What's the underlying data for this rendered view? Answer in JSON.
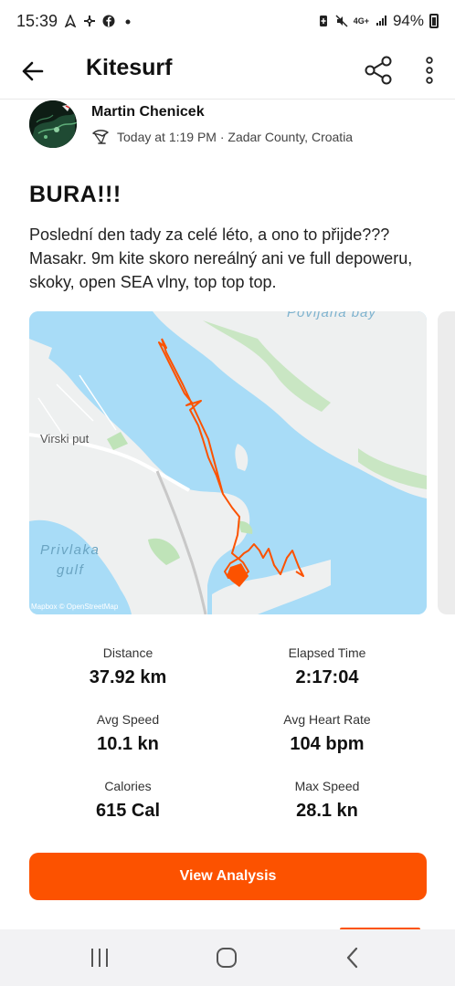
{
  "status_bar": {
    "time": "15:39",
    "battery": "94%",
    "network": "4G+",
    "icons": [
      "navigation-icon",
      "pinwheel-icon",
      "facebook-icon",
      "dot-icon",
      "battery-saver-icon",
      "mute-icon",
      "signal-icon",
      "battery-icon"
    ]
  },
  "app_bar": {
    "title": "Kitesurf",
    "icons": [
      "back-arrow-icon",
      "share-icon",
      "more-vertical-icon"
    ]
  },
  "athlete": {
    "name": "Martin Chenicek",
    "meta": "Today at 1:19 PM · Zadar County, Croatia",
    "sport_icon": "kitesurf-icon"
  },
  "activity": {
    "title": "BURA!!!",
    "description": "Poslední den tady za celé léto, a ono to přijde??? Masakr. 9m kite skoro nereálný ani ve full depoweru, skoky, open SEA vlny, top top top."
  },
  "map": {
    "labels": {
      "bay": "Povljana bay",
      "road": "Virski put",
      "gulf_line1": "Privlaka",
      "gulf_line2": "gulf"
    },
    "attribution": "Mapbox © OpenStreetMap",
    "colors": {
      "water": "#a8dcf7",
      "land": "#eef0f0",
      "park": "#bfe3b8",
      "route": "#fc5200"
    }
  },
  "stats": [
    {
      "label": "Distance",
      "value": "37.92 km"
    },
    {
      "label": "Elapsed Time",
      "value": "2:17:04"
    },
    {
      "label": "Avg Speed",
      "value": "10.1 kn"
    },
    {
      "label": "Avg Heart Rate",
      "value": "104 bpm"
    },
    {
      "label": "Calories",
      "value": "615 Cal"
    },
    {
      "label": "Max Speed",
      "value": "28.1 kn"
    }
  ],
  "cta": {
    "label": "View Analysis",
    "color": "#fc5200"
  },
  "nav_bar": {
    "icons": [
      "recent-apps-icon",
      "home-icon",
      "back-icon"
    ]
  }
}
